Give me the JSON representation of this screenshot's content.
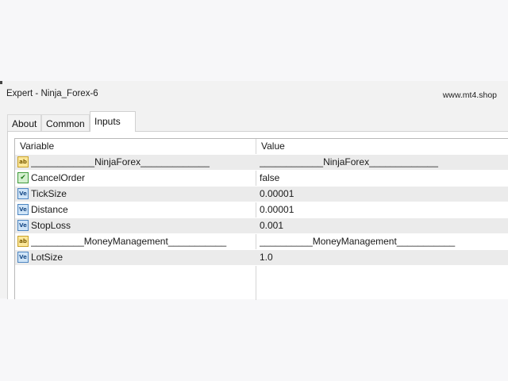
{
  "window": {
    "title": "Expert - Ninja_Forex-6",
    "shop": "www.mt4.shop"
  },
  "tabs": [
    {
      "label": "About"
    },
    {
      "label": "Common"
    },
    {
      "label": "Inputs"
    }
  ],
  "table": {
    "headers": {
      "variable": "Variable",
      "value": "Value"
    },
    "rows": [
      {
        "icon": "string-icon",
        "variable": "____________NinjaForex_____________",
        "value": "____________NinjaForex_____________"
      },
      {
        "icon": "bool-icon",
        "variable": "CancelOrder",
        "value": "false"
      },
      {
        "icon": "double-icon",
        "variable": "TickSize",
        "value": "0.00001"
      },
      {
        "icon": "double-icon",
        "variable": "Distance",
        "value": "0.00001"
      },
      {
        "icon": "double-icon",
        "variable": "StopLoss",
        "value": "0.001"
      },
      {
        "icon": "string-icon",
        "variable": "__________MoneyManagement___________",
        "value": "__________MoneyManagement___________"
      },
      {
        "icon": "double-icon",
        "variable": "LotSize",
        "value": "1.0"
      }
    ]
  }
}
